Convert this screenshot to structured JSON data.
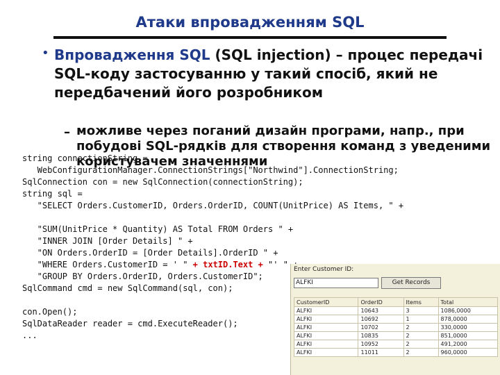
{
  "slide": {
    "title": "Атаки впровадженням SQL",
    "bullet_highlight": "Впровадження SQL",
    "bullet_text": " (SQL injection) – процес передачі SQL-коду застосуванню у такий спосіб, який не передбачений його розробником",
    "sub_bullet": "можливе через поганий дизайн програми, напр., при побудові SQL-рядків для створення команд з уведеними користувачем значеннями",
    "code_lines": [
      "string connectionString =",
      "   WebConfigurationManager.ConnectionStrings[\"Northwind\"].ConnectionString;",
      "SqlConnection con = new SqlConnection(connectionString);",
      "string sql =",
      "   \"SELECT Orders.CustomerID, Orders.OrderID, COUNT(UnitPrice) AS Items, \" +",
      "",
      "   \"SUM(UnitPrice * Quantity) AS Total FROM Orders \" +",
      "   \"INNER JOIN [Order Details] \" +",
      "   \"ON Orders.OrderID = [Order Details].OrderID \" +",
      "   \"WHERE Orders.CustomerID = ' \" + txtID.Text + \"' \" +",
      "   \"GROUP BY Orders.OrderID, Orders.CustomerID\";",
      "SqlCommand cmd = new SqlCommand(sql, con);",
      "",
      "con.Open();",
      "SqlDataReader reader = cmd.ExecuteReader();",
      "..."
    ],
    "code_highlight": "+ txtID.Text +"
  },
  "screenshot": {
    "label": "Enter Customer ID:",
    "input_value": "ALFKI",
    "button_label": "Get Records",
    "columns": [
      "CustomerID",
      "OrderID",
      "Items",
      "Total"
    ],
    "rows": [
      [
        "ALFKI",
        "10643",
        "3",
        "1086,0000"
      ],
      [
        "ALFKI",
        "10692",
        "1",
        "878,0000"
      ],
      [
        "ALFKI",
        "10702",
        "2",
        "330,0000"
      ],
      [
        "ALFKI",
        "10835",
        "2",
        "851,0000"
      ],
      [
        "ALFKI",
        "10952",
        "2",
        "491,2000"
      ],
      [
        "ALFKI",
        "11011",
        "2",
        "960,0000"
      ]
    ]
  }
}
